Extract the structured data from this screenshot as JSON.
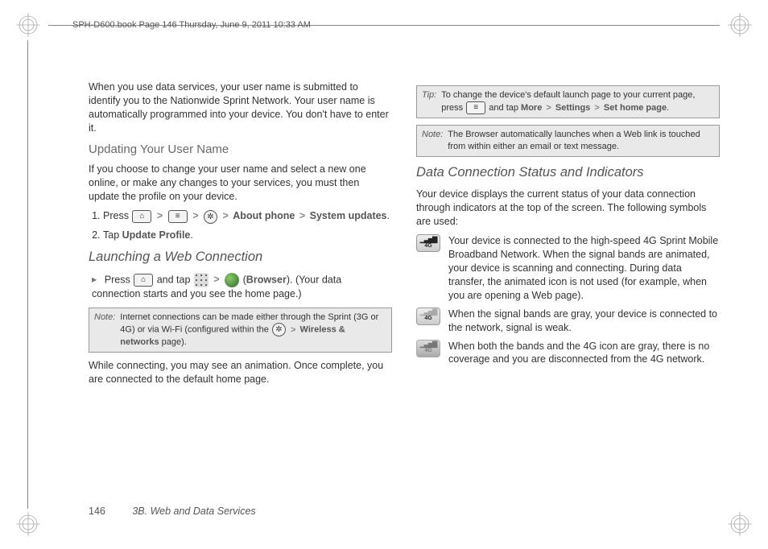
{
  "header": {
    "running": "SPH-D600.book  Page 146  Thursday, June 9, 2011  10:33 AM"
  },
  "left": {
    "p1": "When you use data services, your user name is submitted to identify you to the Nationwide Sprint Network. Your user name is automatically programmed into your device. You don't have to enter it.",
    "h_update": "Updating Your User Name",
    "p2": "If you choose to change your user name and select a new one online, or make any changes to your services, you must then update the profile on your device.",
    "step1_a": "Press ",
    "step1_b": "About phone",
    "step1_c": "System updates",
    "step2_a": "Tap ",
    "step2_b": "Update Profile",
    "h_launch": "Launching a Web Connection",
    "launch_a": "Press ",
    "launch_b": " and tap ",
    "launch_c": "Browser",
    "launch_d": "(Your data connection starts and you see the home page.)",
    "note1_label": "Note:",
    "note1_body_a": "Internet connections can be made either through the Sprint (3G or 4G) or via Wi-Fi (configured within the ",
    "note1_body_b": "Wireless & networks",
    "note1_body_c": " page).",
    "p3": "While connecting, you may see an animation. Once complete, you are connected to the default home page."
  },
  "right": {
    "tip_label": "Tip:",
    "tip_a": "To change the device's default launch page to your current page, press ",
    "tip_b": " and tap ",
    "tip_more": "More",
    "tip_settings": "Settings",
    "tip_sethome": "Set home page",
    "note2_label": "Note:",
    "note2_body": "The Browser automatically launches when a Web link is touched from within either an email or text message.",
    "h_data": "Data Connection Status and Indicators",
    "p1": "Your device displays the current status of your data connection through indicators at the top of the screen. The following symbols are used:",
    "ind1": "Your device is connected to the high-speed 4G Sprint Mobile Broadband Network. When the signal bands are animated, your device is scanning and connecting. During data transfer, the animated icon is not used (for example, when you are opening a Web page).",
    "ind2": "When the signal bands are gray, your device is connected to the network, signal is weak.",
    "ind3": "When both the bands and the 4G icon are gray, there is no coverage and you are disconnected from the 4G network."
  },
  "footer": {
    "page": "146",
    "section": "3B. Web and Data Services"
  },
  "glyphs": {
    "gt": ">",
    "home": "⌂",
    "menu": "≡",
    "gear": "✲",
    "dot": "."
  }
}
